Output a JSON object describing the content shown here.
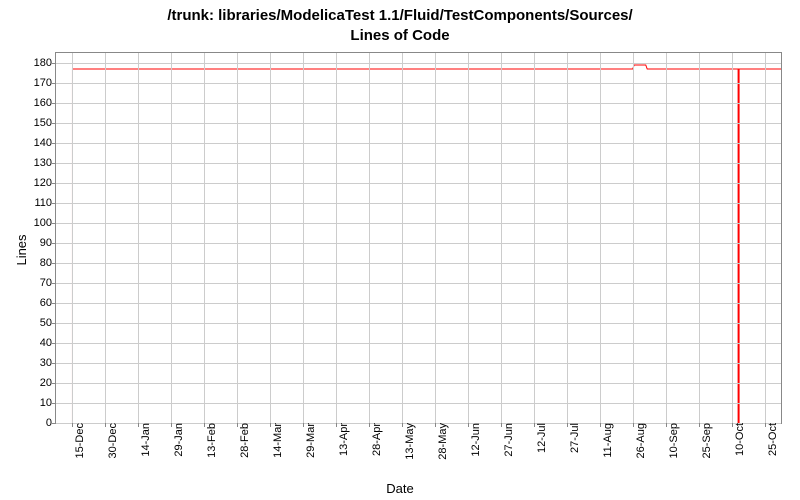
{
  "chart_data": {
    "type": "line",
    "title_line1": "/trunk: libraries/ModelicaTest 1.1/Fluid/TestComponents/Sources/",
    "title_line2": "Lines of Code",
    "xlabel": "Date",
    "ylabel": "Lines",
    "ylim": [
      0,
      185
    ],
    "yticks": [
      0,
      10,
      20,
      30,
      40,
      50,
      60,
      70,
      80,
      90,
      100,
      110,
      120,
      130,
      140,
      150,
      160,
      170,
      180
    ],
    "xticks": [
      "15-Dec",
      "30-Dec",
      "14-Jan",
      "29-Jan",
      "13-Feb",
      "28-Feb",
      "14-Mar",
      "29-Mar",
      "13-Apr",
      "28-Apr",
      "13-May",
      "28-May",
      "12-Jun",
      "27-Jun",
      "12-Jul",
      "27-Jul",
      "11-Aug",
      "26-Aug",
      "10-Sep",
      "25-Sep",
      "10-Oct",
      "25-Oct"
    ],
    "series": [
      {
        "name": "Lines",
        "color": "#ff0000",
        "points": [
          {
            "x": "15-Dec",
            "y_before": 0,
            "y_after": 177
          },
          {
            "x": "26-Aug",
            "y": 177
          },
          {
            "x": "26-Aug+",
            "y": 179
          },
          {
            "x": "01-Sep~",
            "y": 179
          },
          {
            "x": "01-Sep~+",
            "y": 177
          },
          {
            "x": "12-Oct~",
            "y": 177
          },
          {
            "x": "12-Oct~",
            "y_drop": 0
          },
          {
            "x": "12-Oct~",
            "y_after": 177
          },
          {
            "x": "end",
            "y": 177
          }
        ]
      }
    ]
  }
}
